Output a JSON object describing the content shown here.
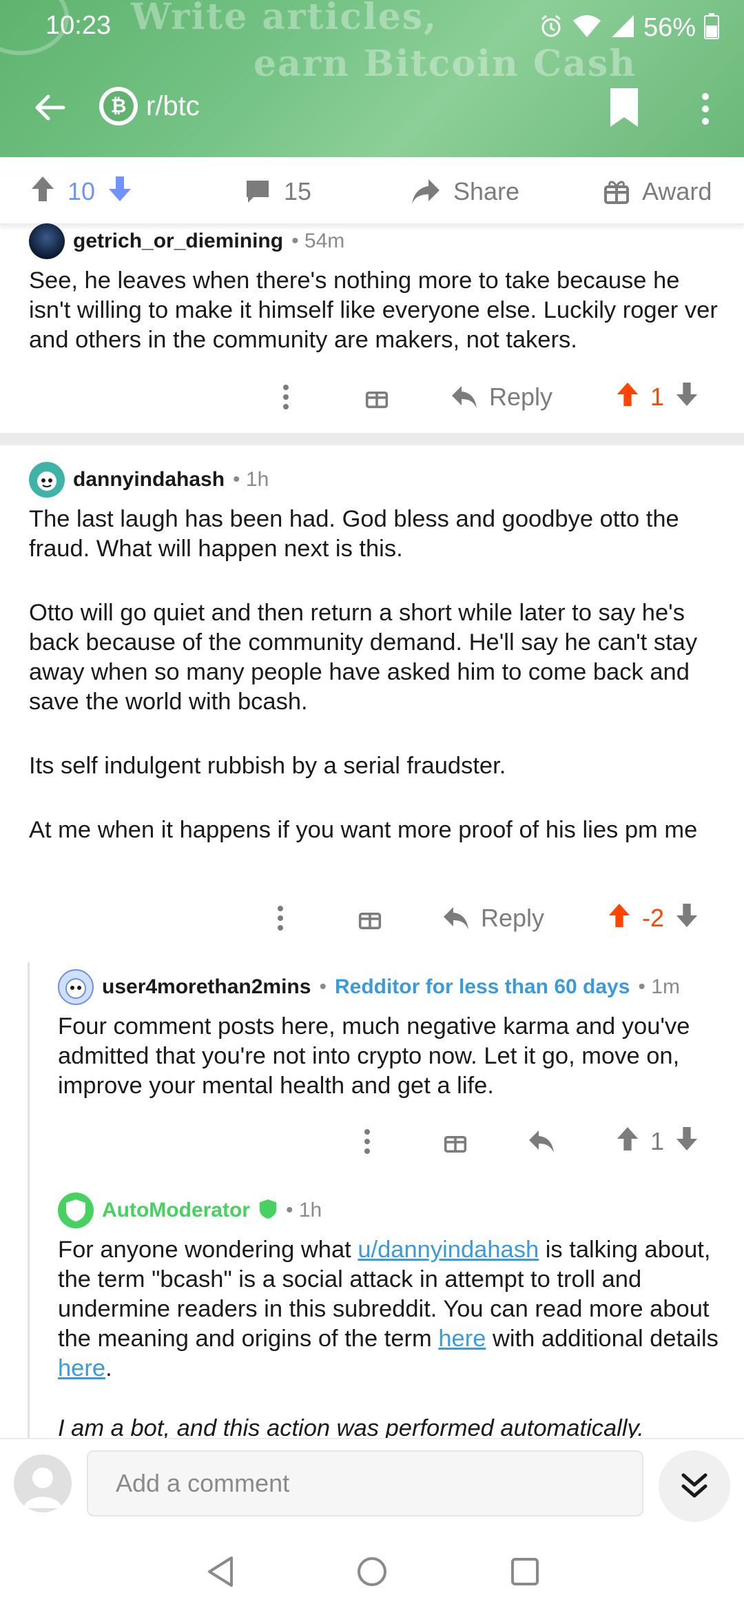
{
  "status": {
    "time": "10:23",
    "battery": "56%"
  },
  "banner": {
    "line1": "Write articles,",
    "line2": "earn Bitcoin Cash"
  },
  "header": {
    "subreddit": "r/btc",
    "sub_icon_glyph": "₿"
  },
  "post_actions": {
    "score": "10",
    "comments": "15",
    "share_label": "Share",
    "award_label": "Award"
  },
  "comments": [
    {
      "author": "getrich_or_diemining",
      "age": "54m",
      "body": [
        "See, he leaves when there's nothing more to take because he isn't willing to make it himself like everyone else. Luckily roger ver and others in the community are makers, not takers."
      ],
      "reply_label": "Reply",
      "score": "1"
    },
    {
      "author": "dannyindahash",
      "age": "1h",
      "body": [
        "The last laugh has been had. God bless and goodbye otto the fraud. What will happen next is this.",
        "Otto will go quiet and then return a short while later to say he's back because of the community demand. He'll say he can't stay away when so many people have asked him to come back and save the world with bcash.",
        "Its self indulgent rubbish by a serial fraudster.",
        "At me when it happens if you want more proof of his lies pm me"
      ],
      "reply_label": "Reply",
      "score": "-2"
    },
    {
      "author": "user4morethan2mins",
      "flair": "Redditor for less than 60 days",
      "age": "1m",
      "body": [
        "Four comment posts here, much negative karma and you've admitted that you're not into crypto now. Let it go, move on, improve your mental health and get a life."
      ],
      "score": "1"
    },
    {
      "author": "AutoModerator",
      "age": "1h",
      "body_parts": {
        "t1": "For anyone wondering what ",
        "link_user": "u/dannyindahash",
        "t2": " is talking about, the term \"bcash\" is a social attack in attempt to troll and undermine readers in this subreddit. You can read more about the meaning and origins of the term ",
        "link_here1": "here",
        "t3": " with additional details ",
        "link_here2": "here",
        "t4": "."
      },
      "bot_note": "I am a bot, and this action was performed automatically."
    }
  ],
  "comment_box": {
    "placeholder": "Add a comment"
  },
  "colors": {
    "header_green": "#5fb36e",
    "upvote_orange": "#ff4500",
    "score_blue": "#7193ff",
    "mod_green": "#46d160",
    "link_blue": "#3a9bdc"
  },
  "icons": [
    "back-arrow-icon",
    "bitcoin-icon",
    "bookmark-icon",
    "more-vert-icon",
    "upvote-icon",
    "downvote-icon",
    "comment-icon",
    "share-icon",
    "gift-icon",
    "reply-icon",
    "shield-icon",
    "chevrons-down-icon",
    "nav-back-icon",
    "nav-home-icon",
    "nav-recents-icon"
  ]
}
